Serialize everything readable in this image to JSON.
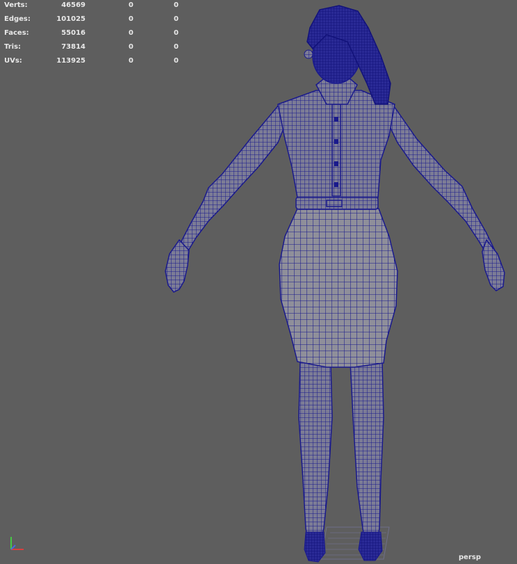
{
  "stats": [
    {
      "label": "Verts:",
      "values": [
        "46569",
        "0",
        "0"
      ]
    },
    {
      "label": "Edges:",
      "values": [
        "101025",
        "0",
        "0"
      ]
    },
    {
      "label": "Faces:",
      "values": [
        "55016",
        "0",
        "0"
      ]
    },
    {
      "label": "Tris:",
      "values": [
        "73814",
        "0",
        "0"
      ]
    },
    {
      "label": "UVs:",
      "values": [
        "113925",
        "0",
        "0"
      ]
    }
  ],
  "camera": "persp",
  "wire_color": "#1a1a8c",
  "surface_color": "#8f8f9a"
}
